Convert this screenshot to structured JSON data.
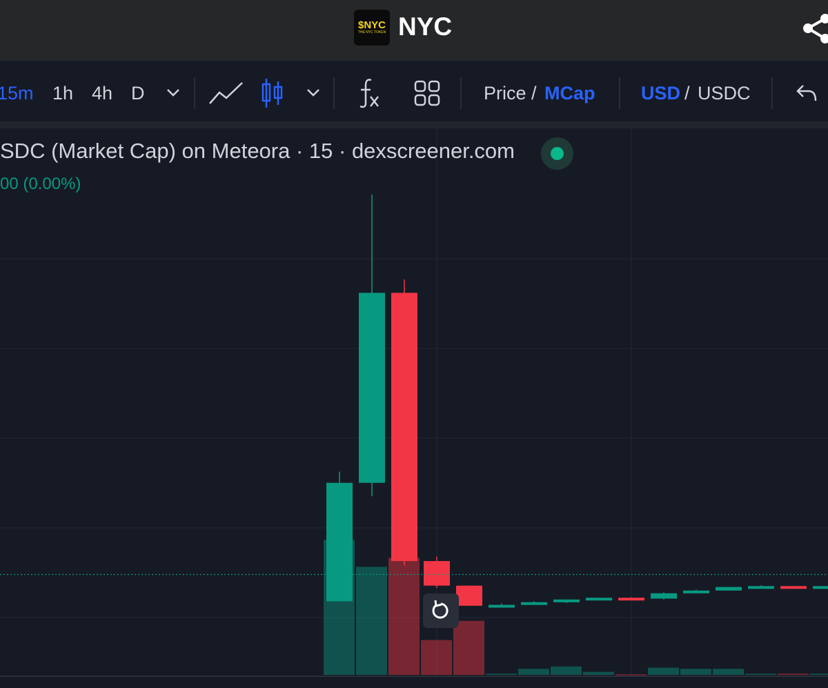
{
  "header": {
    "logo_line1": "$NYC",
    "logo_line2": "THE NYC TOKEN",
    "token_name": "NYC",
    "share_icon": "share-icon"
  },
  "toolbar": {
    "intervals": [
      "15m",
      "1h",
      "4h",
      "D"
    ],
    "active_interval": "15m",
    "interval_menu_icon": "chevron-down-icon",
    "line_chart_icon": "line-chart-icon",
    "candle_chart_icon": "candlestick-icon",
    "chart_type_menu_icon": "chevron-down-icon",
    "indicators_icon": "fx-icon",
    "layout_icon": "grid-layout-icon",
    "price_label": "Price",
    "mcap_label": "MCap",
    "slash": "/",
    "usd_label": "USD",
    "usdc_label": "USDC",
    "undo_icon": "undo-icon"
  },
  "colors": {
    "up": "#089981",
    "down": "#f23645",
    "accent": "#2962ff",
    "background": "#161a25"
  },
  "legend": {
    "title": "SDC (Market Cap) on Meteora · 15 · dexscreener.com",
    "change": "00 (0.00%)",
    "status_icon": "market-status-dot"
  },
  "reset_button_icon": "reset-icon",
  "chart_data": {
    "type": "candlestick",
    "y_scale_note": "no price axis visible; values are relative market-cap units",
    "candles": [
      {
        "open": 1.6,
        "high": 4.5,
        "low": 1.6,
        "close": 4.25,
        "volume": 2.25
      },
      {
        "open": 4.25,
        "high": 10.7,
        "low": 3.95,
        "close": 8.5,
        "volume": 1.8
      },
      {
        "open": 8.5,
        "high": 8.8,
        "low": 2.4,
        "close": 2.5,
        "volume": 1.95
      },
      {
        "open": 2.5,
        "high": 2.6,
        "low": 1.9,
        "close": 1.95,
        "volume": 0.58
      },
      {
        "open": 1.95,
        "high": 1.95,
        "low": 1.5,
        "close": 1.5,
        "volume": 0.9
      },
      {
        "open": 1.5,
        "high": 1.55,
        "low": 1.48,
        "close": 1.52,
        "volume": 0.02
      },
      {
        "open": 1.52,
        "high": 1.6,
        "low": 1.52,
        "close": 1.58,
        "volume": 0.1
      },
      {
        "open": 1.58,
        "high": 1.64,
        "low": 1.56,
        "close": 1.64,
        "volume": 0.14
      },
      {
        "open": 1.64,
        "high": 1.68,
        "low": 1.62,
        "close": 1.68,
        "volume": 0.05
      },
      {
        "open": 1.68,
        "high": 1.69,
        "low": 1.65,
        "close": 1.66,
        "volume": 0.01
      },
      {
        "open": 1.66,
        "high": 1.8,
        "low": 1.64,
        "close": 1.78,
        "volume": 0.12
      },
      {
        "open": 1.78,
        "high": 1.86,
        "low": 1.78,
        "close": 1.84,
        "volume": 0.1
      },
      {
        "open": 1.84,
        "high": 1.92,
        "low": 1.84,
        "close": 1.92,
        "volume": 0.1
      },
      {
        "open": 1.92,
        "high": 1.96,
        "low": 1.9,
        "close": 1.94,
        "volume": 0.02
      },
      {
        "open": 1.94,
        "high": 1.94,
        "low": 1.88,
        "close": 1.88,
        "volume": 0.02
      },
      {
        "open": 1.88,
        "high": 1.94,
        "low": 1.88,
        "close": 1.94,
        "volume": 0.02
      }
    ],
    "last_value_line": 2.2,
    "ylim": [
      0,
      11.5
    ],
    "grid": true
  }
}
